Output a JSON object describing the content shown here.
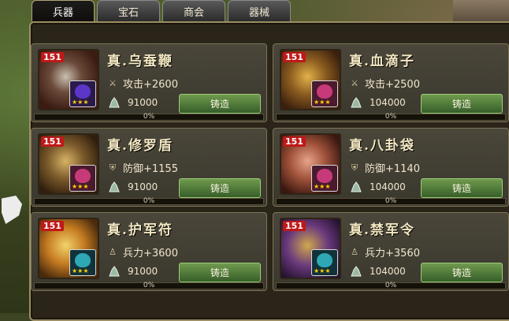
{
  "tabs": [
    {
      "label": "兵器",
      "active": true
    },
    {
      "label": "宝石",
      "active": false
    },
    {
      "label": "商会",
      "active": false
    },
    {
      "label": "器械",
      "active": false
    }
  ],
  "forge_label": "铸造",
  "items": [
    {
      "name": "真.乌蚕鞭",
      "level": "151",
      "stat": "攻击+2600",
      "stat_icon": "sword-icon",
      "cost": "91000",
      "progress": "0%",
      "progress_value": 0,
      "gem_color": "#5b36c8",
      "stars": "★★★"
    },
    {
      "name": "真.血滴子",
      "level": "151",
      "stat": "攻击+2500",
      "stat_icon": "sword-icon",
      "cost": "104000",
      "progress": "0%",
      "progress_value": 0,
      "gem_color": "#c73a7a",
      "stars": "★★★"
    },
    {
      "name": "真.修罗盾",
      "level": "151",
      "stat": "防御+1155",
      "stat_icon": "shield-icon",
      "cost": "91000",
      "progress": "0%",
      "progress_value": 0,
      "gem_color": "#c73a7a",
      "stars": "★★★"
    },
    {
      "name": "真.八卦袋",
      "level": "151",
      "stat": "防御+1140",
      "stat_icon": "shield-icon",
      "cost": "104000",
      "progress": "0%",
      "progress_value": 0,
      "gem_color": "#c73a7a",
      "stars": "★★★"
    },
    {
      "name": "真.护军符",
      "level": "151",
      "stat": "兵力+3600",
      "stat_icon": "soldier-icon",
      "cost": "91000",
      "progress": "0%",
      "progress_value": 0,
      "gem_color": "#2fa7b5",
      "stars": "★★★"
    },
    {
      "name": "真.禁军令",
      "level": "151",
      "stat": "兵力+3560",
      "stat_icon": "soldier-icon",
      "cost": "104000",
      "progress": "0%",
      "progress_value": 0,
      "gem_color": "#2fa7b5",
      "stars": "★★★"
    }
  ]
}
